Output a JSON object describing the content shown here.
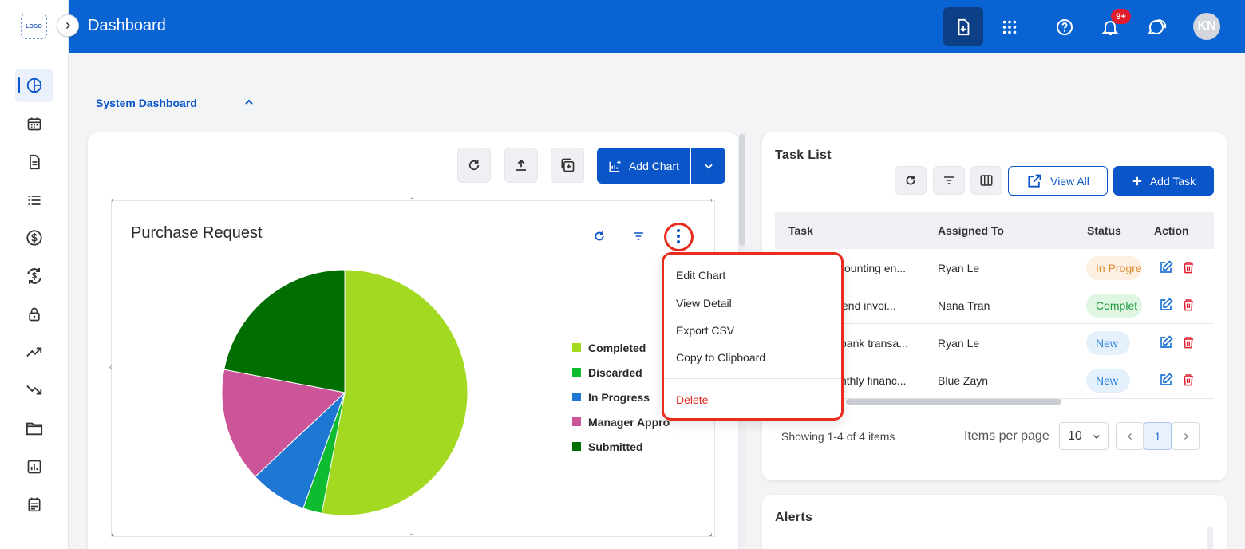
{
  "header": {
    "title": "Dashboard",
    "notification_count": "9+",
    "avatar_initials": "KN"
  },
  "rail": {
    "logo_text": "LOGO",
    "items": [
      "dashboard-icon",
      "calendar-icon",
      "document-icon",
      "list-icon",
      "dollar-icon",
      "exchange-icon",
      "lock-icon",
      "trending-up-icon",
      "trending-down-icon",
      "folder-icon",
      "report-icon",
      "notes-icon"
    ]
  },
  "section": {
    "title": "System Dashboard"
  },
  "chart_panel": {
    "add_chart_label": "Add Chart",
    "widget_title": "Purchase Request"
  },
  "menu": {
    "items": [
      "Edit Chart",
      "View Detail",
      "Export CSV",
      "Copy to Clipboard"
    ],
    "danger_item": "Delete"
  },
  "chart_data": {
    "type": "pie",
    "title": "Purchase Request",
    "slices": [
      {
        "label": "Completed",
        "value": 53,
        "color": "#a3d920"
      },
      {
        "label": "Discarded",
        "value": 2.5,
        "color": "#0fbb2f"
      },
      {
        "label": "In Progress",
        "value": 7.5,
        "color": "#1f77d4"
      },
      {
        "label": "Manager Approval",
        "value": 15,
        "color": "#cc5599"
      },
      {
        "label": "Submitted",
        "value": 22,
        "color": "#006e00"
      }
    ],
    "legend_labels": [
      "Completed",
      "Discarded",
      "In Progress",
      "Manager Appro",
      "Submitted"
    ],
    "legend_position": "right"
  },
  "task_list": {
    "title": "Task List",
    "view_all_label": "View All",
    "add_task_label": "Add Task",
    "columns": [
      "Task",
      "Assigned To",
      "Status",
      "Action"
    ],
    "rows": [
      {
        "task": "counting en...",
        "assigned": "Ryan Le",
        "status": "In Progre",
        "status_type": "inprog"
      },
      {
        "task": "send invoi...",
        "assigned": "Nana Tran",
        "status": "Complet",
        "status_type": "complete"
      },
      {
        "task": "bank transa...",
        "assigned": "Ryan Le",
        "status": "New",
        "status_type": "new"
      },
      {
        "task": "nthly financ...",
        "assigned": "Blue Zayn",
        "status": "New",
        "status_type": "new"
      }
    ],
    "showing": "Showing 1-4 of 4 items",
    "items_per_page_label": "Items per page",
    "items_per_page": "10",
    "current_page": "1"
  },
  "alerts": {
    "title": "Alerts"
  }
}
